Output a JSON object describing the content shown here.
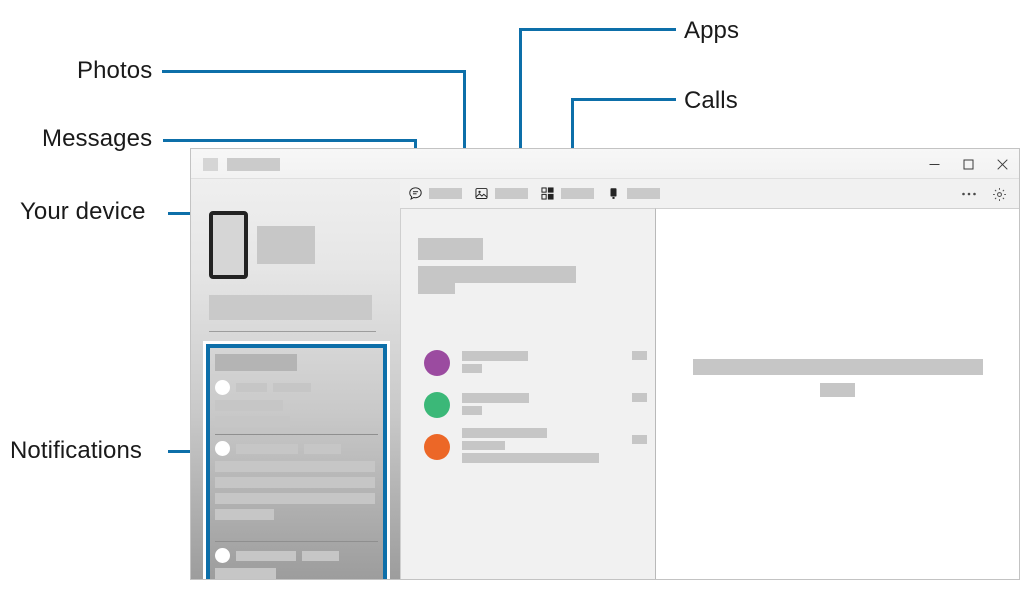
{
  "annotations": {
    "accent_color": "#0d6fa9",
    "items": [
      {
        "id": "apps",
        "label": "Apps"
      },
      {
        "id": "photos",
        "label": "Photos"
      },
      {
        "id": "calls",
        "label": "Calls"
      },
      {
        "id": "messages",
        "label": "Messages"
      },
      {
        "id": "your-device",
        "label": "Your device"
      },
      {
        "id": "notifications",
        "label": "Notifications"
      }
    ]
  },
  "window": {
    "title": "",
    "controls": {
      "minimize": "minimize-icon",
      "maximize": "maximize-icon",
      "close": "close-icon",
      "more": "more-options-icon",
      "settings": "gear-icon"
    }
  },
  "tabs": [
    {
      "id": "messages",
      "icon": "message-bubble-icon",
      "label": "",
      "active": true
    },
    {
      "id": "photos",
      "icon": "photo-icon",
      "label": "",
      "active": false
    },
    {
      "id": "apps",
      "icon": "apps-grid-icon",
      "label": "",
      "active": false
    },
    {
      "id": "calls",
      "icon": "phone-device-icon",
      "label": "",
      "active": false
    }
  ],
  "sidebar": {
    "device_icon": "phone-outline-icon",
    "notifications": {
      "groups": [
        {
          "avatar": "white-dot-avatar"
        },
        {
          "avatar": "white-dot-avatar"
        },
        {
          "avatar": "white-dot-avatar"
        }
      ]
    }
  },
  "conversations": {
    "rows": [
      {
        "avatar_color": "#9b4ba0",
        "name": "",
        "preview": "",
        "time": ""
      },
      {
        "avatar_color": "#3bb878",
        "name": "",
        "preview": "",
        "time": ""
      },
      {
        "avatar_color": "#ec6727",
        "name": "",
        "preview": "",
        "time": ""
      }
    ]
  },
  "right_panel": {
    "message_placeholder": "",
    "action_placeholder": ""
  }
}
